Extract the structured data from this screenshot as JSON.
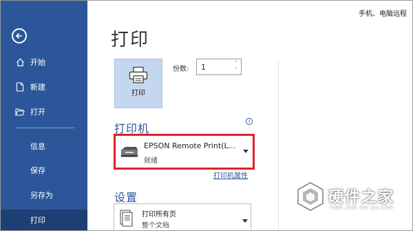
{
  "top_right_text": "手机、电脑远程",
  "sidebar": {
    "items": [
      {
        "label": "开始",
        "icon": "home-icon"
      },
      {
        "label": "新建",
        "icon": "new-document-icon"
      },
      {
        "label": "打开",
        "icon": "folder-open-icon"
      },
      {
        "label": "信息"
      },
      {
        "label": "保存"
      },
      {
        "label": "另存为"
      },
      {
        "label": "打印",
        "active": true
      }
    ]
  },
  "main": {
    "title": "打印",
    "print_button_label": "打印",
    "copies_label": "份数:",
    "copies_value": "1",
    "printer_section_title": "打印机",
    "printer_name": "EPSON Remote Print(L...",
    "printer_status": "就绪",
    "printer_properties_link": "打印机属性",
    "settings_section_title": "设置",
    "settings_option_line1": "打印所有页",
    "settings_option_line2": "整个文档"
  },
  "watermark": {
    "text": "硬件之家",
    "subtext": "YING JIAN ZHI JIA.COM"
  },
  "colors": {
    "sidebar_bg": "#2b579a",
    "sidebar_active": "#1e3f73",
    "highlight_border": "#e0202a",
    "accent": "#2b579a"
  }
}
